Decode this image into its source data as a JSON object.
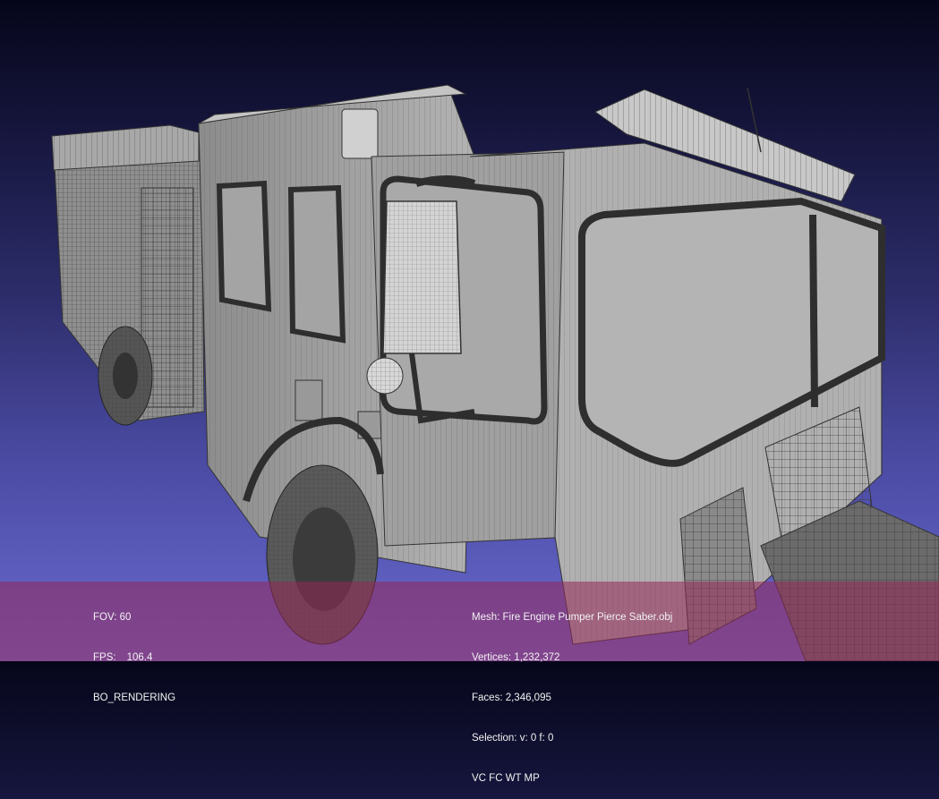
{
  "viewport": {
    "subject": "fire-engine-wireframe-mesh",
    "background_top": "#06061a",
    "background_bottom": "#6a6ad0",
    "overlay_color": "#962a5a"
  },
  "render_info": {
    "fov_label": "FOV:",
    "fov_value": "60",
    "fps_label": "FPS:",
    "fps_value": "106.4",
    "render_mode": "BO_RENDERING"
  },
  "mesh_info": {
    "mesh": "Mesh: Fire Engine Pumper Pierce Saber.obj",
    "vertices": "Vertices: 1,232,372",
    "faces": "Faces: 2,346,095",
    "selection": "Selection: v: 0 f: 0",
    "flags": "VC FC WT MP"
  }
}
